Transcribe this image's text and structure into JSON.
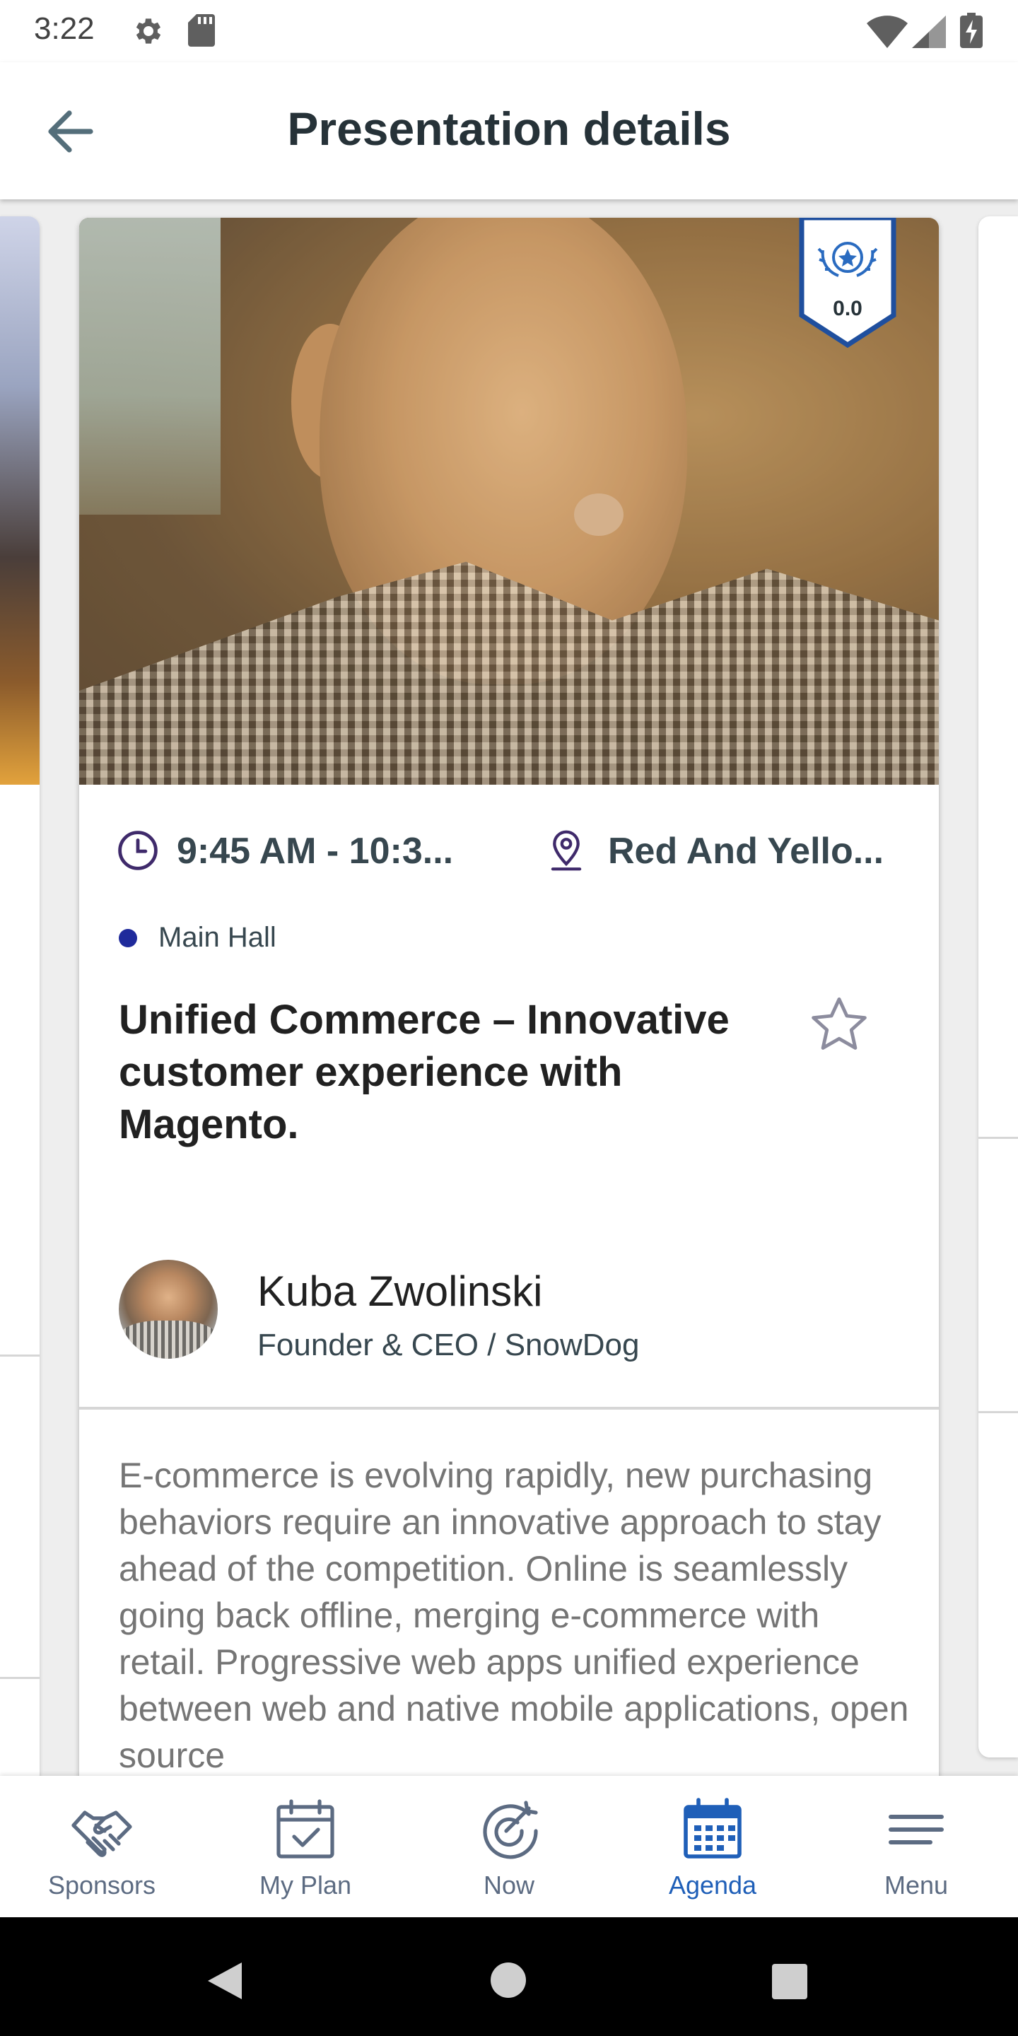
{
  "status_bar": {
    "time": "3:22",
    "icons": [
      "gear-icon",
      "sd-card-icon",
      "wifi-icon",
      "signal-icon",
      "battery-charging-icon"
    ]
  },
  "app_bar": {
    "back_icon": "arrow-left-icon",
    "title": "Presentation details"
  },
  "presentation": {
    "rating": "0.0",
    "rating_icon": "award-laurel-icon",
    "time": "9:45 AM - 10:3...",
    "location": "Red And Yello...",
    "track": "Main Hall",
    "track_color": "#1f2a9b",
    "title": "Unified Commerce – Innovative customer experience with Magento.",
    "favorite_icon": "star-outline-icon",
    "speaker": {
      "name": "Kuba Zwolinski",
      "role": "Founder & CEO / SnowDog"
    },
    "description": "E-commerce is evolving rapidly, new purchasing behaviors require an innovative approach to stay ahead of the competition. Online is seamlessly going back offline, merging e-commerce with retail. Progressive web apps unified experience between web and native mobile applications, open source"
  },
  "bottom_nav": {
    "active_color": "#1f5fb8",
    "inactive_color": "#5c6b82",
    "items": [
      {
        "label": "Sponsors",
        "icon": "handshake-icon",
        "active": false
      },
      {
        "label": "My Plan",
        "icon": "calendar-check-icon",
        "active": false
      },
      {
        "label": "Now",
        "icon": "target-icon",
        "active": false
      },
      {
        "label": "Agenda",
        "icon": "calendar-grid-icon",
        "active": true
      },
      {
        "label": "Menu",
        "icon": "menu-icon",
        "active": false
      }
    ]
  },
  "system_nav": {
    "icons": [
      "back-triangle-icon",
      "home-circle-icon",
      "recents-square-icon"
    ]
  }
}
